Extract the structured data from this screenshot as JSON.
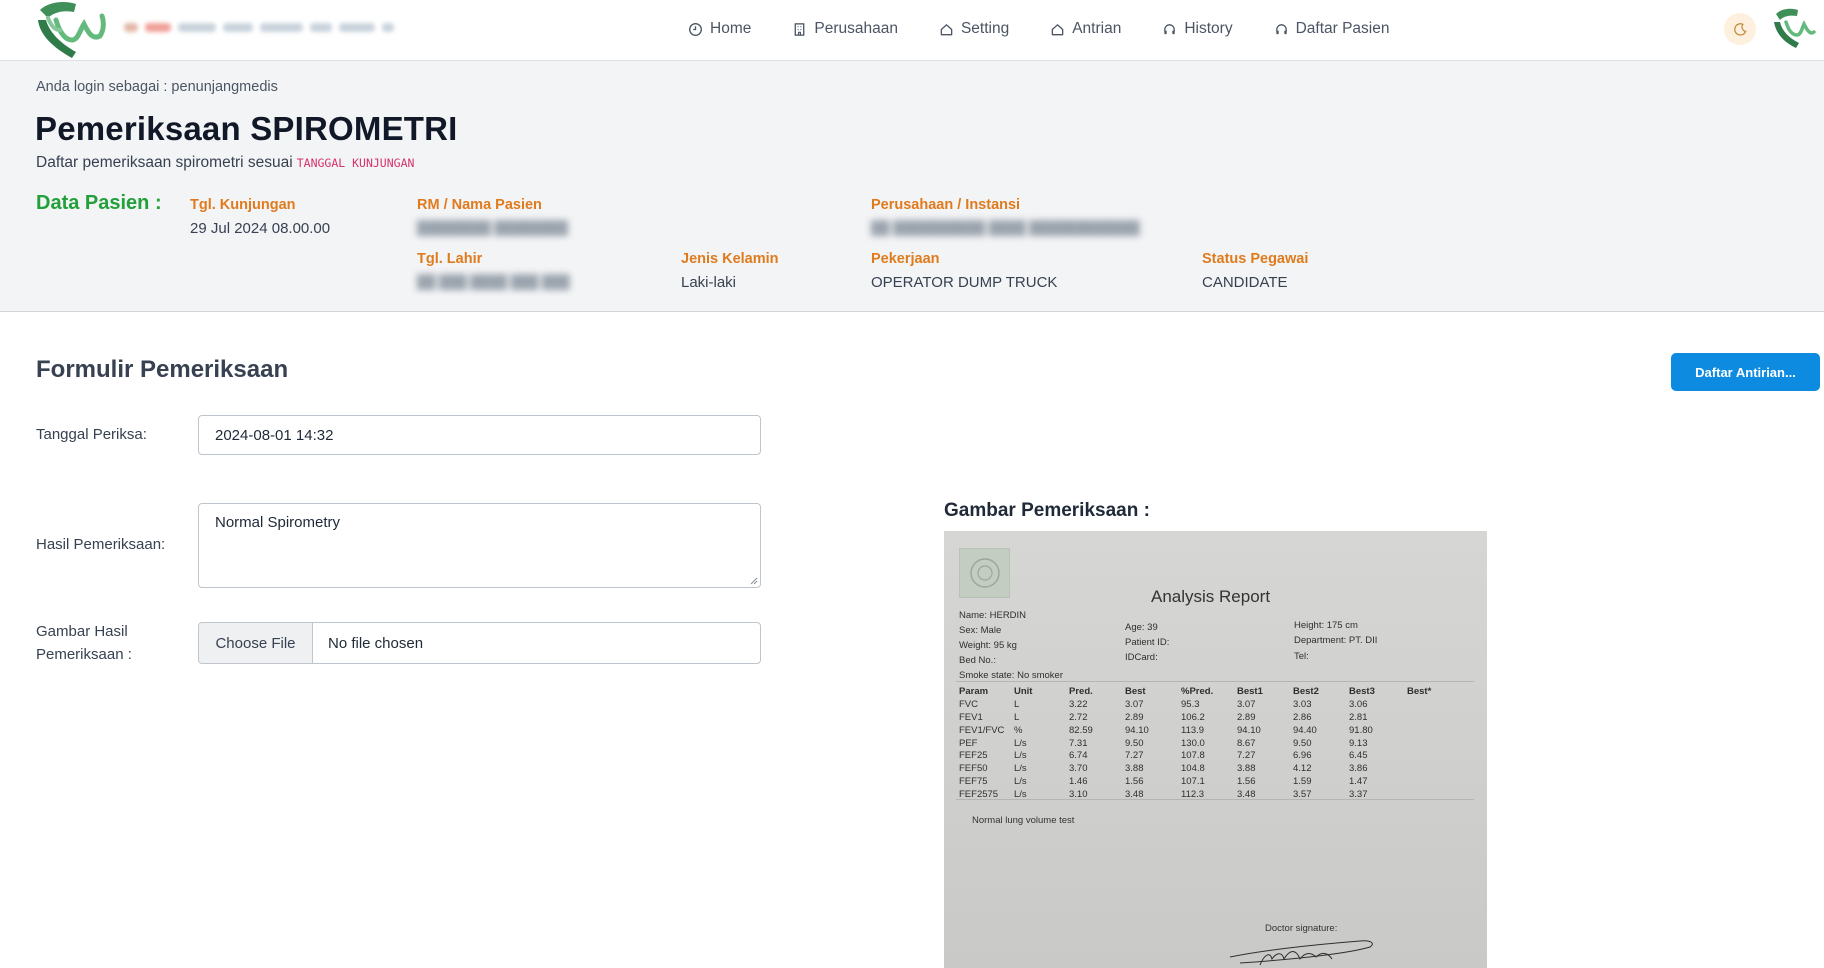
{
  "nav": {
    "items": [
      {
        "label": "Home",
        "icon": "clock-icon"
      },
      {
        "label": "Perusahaan",
        "icon": "building-icon"
      },
      {
        "label": "Setting",
        "icon": "home-icon"
      },
      {
        "label": "Antrian",
        "icon": "home-icon"
      },
      {
        "label": "History",
        "icon": "headset-icon"
      },
      {
        "label": "Daftar Pasien",
        "icon": "headset-icon"
      }
    ]
  },
  "header": {
    "login_info": "Anda login sebagai : penunjangmedis",
    "title": "Pemeriksaan SPIROMETRI",
    "subtitle": "Daftar pemeriksaan spirometri sesuai",
    "subtitle_code": "TANGGAL KUNJUNGAN",
    "data_pasien_title": "Data Pasien :"
  },
  "patient": {
    "tgl_kunjungan": {
      "label": "Tgl. Kunjungan",
      "value": "29 Jul 2024 08.00.00"
    },
    "rm_nama": {
      "label": "RM / Nama Pasien",
      "value": ""
    },
    "perusahaan": {
      "label": "Perusahaan / Instansi",
      "value": ""
    },
    "tgl_lahir": {
      "label": "Tgl. Lahir",
      "value": ""
    },
    "jenis_kelamin": {
      "label": "Jenis Kelamin",
      "value": "Laki-laki"
    },
    "pekerjaan": {
      "label": "Pekerjaan",
      "value": "OPERATOR DUMP TRUCK"
    },
    "status_pegawai": {
      "label": "Status Pegawai",
      "value": "CANDIDATE"
    }
  },
  "form": {
    "title": "Formulir Pemeriksaan",
    "queue_button": "Daftar Antirian...",
    "tanggal_label": "Tanggal Periksa:",
    "tanggal_value": "2024-08-01 14:32",
    "hasil_label": "Hasil Pemeriksaan:",
    "hasil_value": "Normal Spirometry",
    "gambar_label": "Gambar Hasil Pemeriksaan :",
    "file_button": "Choose File",
    "file_status": "No file chosen"
  },
  "gambar": {
    "title": "Gambar Pemeriksaan :",
    "report": {
      "title": "Analysis Report",
      "name": "Name: HERDIN",
      "sex": "Sex:   Male",
      "weight": "Weight:   95 kg",
      "bed": "Bed No.:",
      "smoke": "Smoke state:   No smoker",
      "age": "Age:   39",
      "patient_id": "Patient ID:",
      "idcard": "IDCard:",
      "height": "Height:   175 cm",
      "department": "Department: PT. DII",
      "tel": "Tel:",
      "columns": [
        "Param",
        "Unit",
        "Pred.",
        "Best",
        "%Pred.",
        "Best1",
        "Best2",
        "Best3",
        "Best*"
      ],
      "rows": [
        [
          "FVC",
          "L",
          "3.22",
          "3.07",
          "95.3",
          "3.07",
          "3.03",
          "3.06",
          ""
        ],
        [
          "FEV1",
          "L",
          "2.72",
          "2.89",
          "106.2",
          "2.89",
          "2.86",
          "2.81",
          ""
        ],
        [
          "FEV1/FVC",
          "%",
          "82.59",
          "94.10",
          "113.9",
          "94.10",
          "94.40",
          "91.80",
          ""
        ],
        [
          "PEF",
          "L/s",
          "7.31",
          "9.50",
          "130.0",
          "8.67",
          "9.50",
          "9.13",
          ""
        ],
        [
          "FEF25",
          "L/s",
          "6.74",
          "7.27",
          "107.8",
          "7.27",
          "6.96",
          "6.45",
          ""
        ],
        [
          "FEF50",
          "L/s",
          "3.70",
          "3.88",
          "104.8",
          "3.88",
          "4.12",
          "3.86",
          ""
        ],
        [
          "FEF75",
          "L/s",
          "1.46",
          "1.56",
          "107.1",
          "1.56",
          "1.59",
          "1.47",
          ""
        ],
        [
          "FEF2575",
          "L/s",
          "3.10",
          "3.48",
          "112.3",
          "3.48",
          "3.57",
          "3.37",
          ""
        ]
      ],
      "note": "Normal lung volume test",
      "doctor_signature": "Doctor signature:"
    }
  },
  "colors": {
    "accent_orange": "#e07b1d",
    "accent_green": "#22a03a",
    "primary_button": "#0d8be0",
    "code_pink": "#d6336c"
  }
}
